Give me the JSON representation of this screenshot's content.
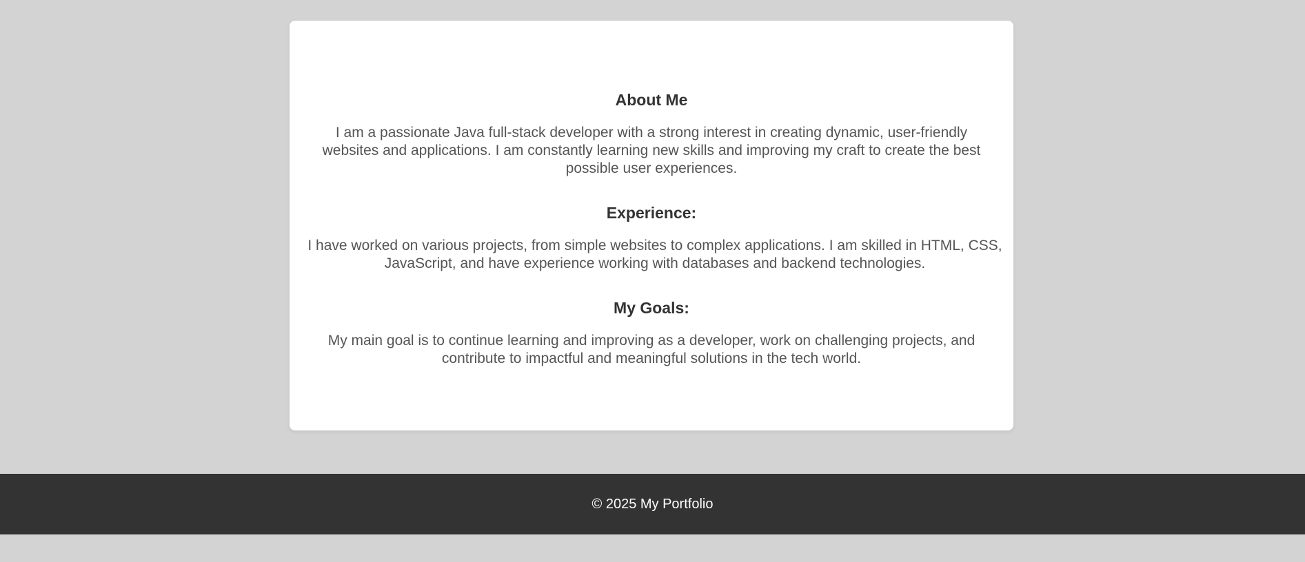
{
  "about": {
    "title": "About Me",
    "text": "I am a passionate Java full-stack developer with a strong interest in creating dynamic, user-friendly websites and applications. I am constantly learning new skills and improving my craft to create the best possible user experiences."
  },
  "experience": {
    "title": "Experience:",
    "text": "I have worked on various projects, from simple websites to complex applications. I am skilled in HTML, CSS, JavaScript, and have experience working with databases and backend technologies."
  },
  "goals": {
    "title": "My Goals:",
    "text": "My main goal is to continue learning and improving as a developer, work on challenging projects, and contribute to impactful and meaningful solutions in the tech world."
  },
  "footer": {
    "copyright": "© 2025 My Portfolio"
  },
  "colors": {
    "background": "#d3d3d3",
    "card": "#ffffff",
    "footer": "#333333",
    "heading": "#333333",
    "body_text": "#555555"
  }
}
